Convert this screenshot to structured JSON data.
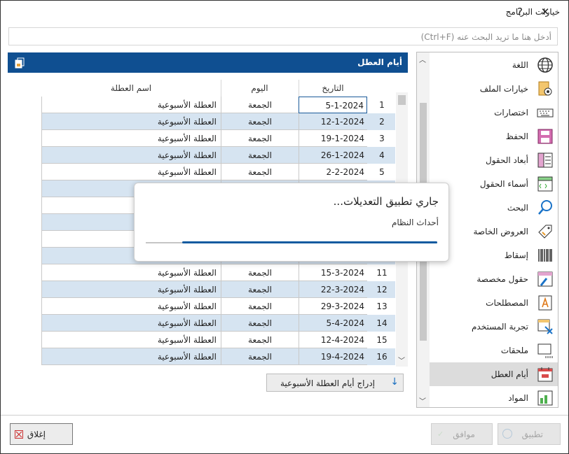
{
  "window": {
    "title": "خيارات البرنامج",
    "help_label": "?",
    "close_label": "✕"
  },
  "search": {
    "placeholder": "أدخل هنا ما تريد البحث عنه (Ctrl+F)"
  },
  "sidebar": {
    "items": [
      {
        "label": "اللغة",
        "icon": "globe-icon"
      },
      {
        "label": "خيارات الملف",
        "icon": "file-settings-icon"
      },
      {
        "label": "اختصارات",
        "icon": "keyboard-icon"
      },
      {
        "label": "الحفظ",
        "icon": "save-icon"
      },
      {
        "label": "أبعاد الحقول",
        "icon": "field-dimensions-icon"
      },
      {
        "label": "أسماء الحقول",
        "icon": "field-names-icon"
      },
      {
        "label": "البحث",
        "icon": "search-icon"
      },
      {
        "label": "العروض الخاصة",
        "icon": "tag-icon"
      },
      {
        "label": "إسقاط",
        "icon": "barcode-icon"
      },
      {
        "label": "حقول مخصصة",
        "icon": "custom-fields-icon"
      },
      {
        "label": "المصطلحات",
        "icon": "terms-icon"
      },
      {
        "label": "تجربة المستخدم",
        "icon": "user-experience-icon"
      },
      {
        "label": "ملحقات",
        "icon": "addons-icon"
      },
      {
        "label": "أيام العطل",
        "icon": "calendar-icon"
      },
      {
        "label": "المواد",
        "icon": "materials-icon"
      }
    ],
    "selected_index": 13
  },
  "panel": {
    "title": "أيام العطل"
  },
  "table": {
    "columns": {
      "name": "اسم العطلة",
      "day": "اليوم",
      "date": "التاريخ"
    },
    "rows": [
      {
        "num": "1",
        "date": "5-1-2024",
        "day": "الجمعة",
        "name": "العطلة الأسبوعية"
      },
      {
        "num": "2",
        "date": "12-1-2024",
        "day": "الجمعة",
        "name": "العطلة الأسبوعية"
      },
      {
        "num": "3",
        "date": "19-1-2024",
        "day": "الجمعة",
        "name": "العطلة الأسبوعية"
      },
      {
        "num": "4",
        "date": "26-1-2024",
        "day": "الجمعة",
        "name": "العطلة الأسبوعية"
      },
      {
        "num": "5",
        "date": "2-2-2024",
        "day": "الجمعة",
        "name": "العطلة الأسبوعية"
      },
      {
        "num": "",
        "date": "",
        "day": "",
        "name": ""
      },
      {
        "num": "",
        "date": "",
        "day": "",
        "name": ""
      },
      {
        "num": "",
        "date": "",
        "day": "",
        "name": ""
      },
      {
        "num": "",
        "date": "",
        "day": "",
        "name": ""
      },
      {
        "num": "",
        "date": "",
        "day": "",
        "name": ""
      },
      {
        "num": "11",
        "date": "15-3-2024",
        "day": "الجمعة",
        "name": "العطلة الأسبوعية"
      },
      {
        "num": "12",
        "date": "22-3-2024",
        "day": "الجمعة",
        "name": "العطلة الأسبوعية"
      },
      {
        "num": "13",
        "date": "29-3-2024",
        "day": "الجمعة",
        "name": "العطلة الأسبوعية"
      },
      {
        "num": "14",
        "date": "5-4-2024",
        "day": "الجمعة",
        "name": "العطلة الأسبوعية"
      },
      {
        "num": "15",
        "date": "12-4-2024",
        "day": "الجمعة",
        "name": "العطلة الأسبوعية"
      },
      {
        "num": "16",
        "date": "19-4-2024",
        "day": "الجمعة",
        "name": "العطلة الأسبوعية"
      }
    ]
  },
  "insert_button": {
    "label": "إدراج أيام العطلة الأسبوعية",
    "icon": "arrow-down-icon"
  },
  "progress_popup": {
    "title": "جاري تطبيق التعديلات...",
    "subtitle": "أحداث النظام",
    "progress_start": 0.125,
    "progress_end": 1.0
  },
  "footer": {
    "close_label": "إغلاق",
    "ok_label": "موافق",
    "apply_label": "تطبيق"
  },
  "colors": {
    "accent": "#0f4f91",
    "row_alt": "#d6e4f1",
    "progress": "#0f5aa0"
  }
}
